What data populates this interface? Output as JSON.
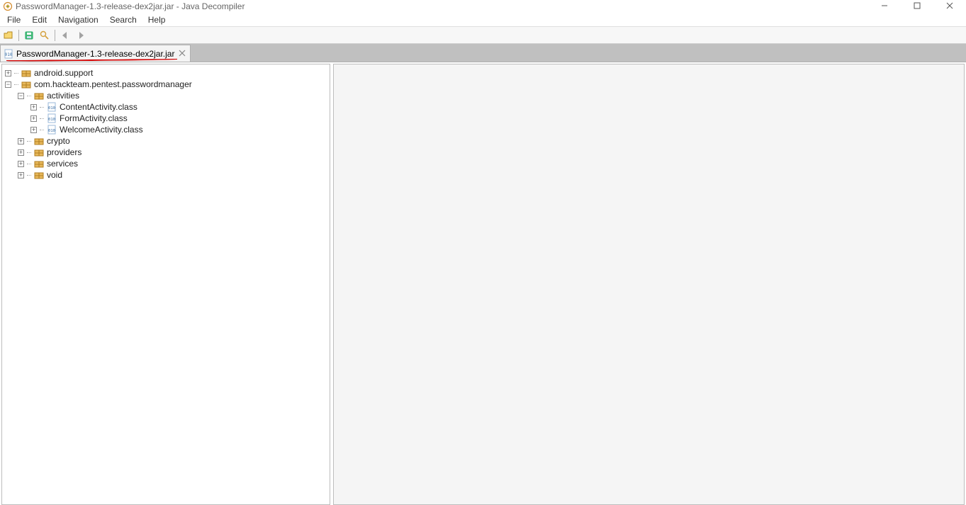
{
  "window": {
    "title": "PasswordManager-1.3-release-dex2jar.jar - Java Decompiler"
  },
  "menubar": [
    "File",
    "Edit",
    "Navigation",
    "Search",
    "Help"
  ],
  "tabs": [
    {
      "label": "PasswordManager-1.3-release-dex2jar.jar"
    }
  ],
  "tree": {
    "nodes": [
      {
        "type": "package",
        "label": "android.support",
        "expanded": false
      },
      {
        "type": "package",
        "label": "com.hackteam.pentest.passwordmanager",
        "expanded": true,
        "children": [
          {
            "type": "package",
            "label": "activities",
            "expanded": true,
            "children": [
              {
                "type": "class",
                "label": "ContentActivity.class"
              },
              {
                "type": "class",
                "label": "FormActivity.class"
              },
              {
                "type": "class",
                "label": "WelcomeActivity.class"
              }
            ]
          },
          {
            "type": "package",
            "label": "crypto",
            "expanded": false
          },
          {
            "type": "package",
            "label": "providers",
            "expanded": false
          },
          {
            "type": "package",
            "label": "services",
            "expanded": false
          },
          {
            "type": "package",
            "label": "void",
            "expanded": false
          }
        ]
      }
    ]
  }
}
